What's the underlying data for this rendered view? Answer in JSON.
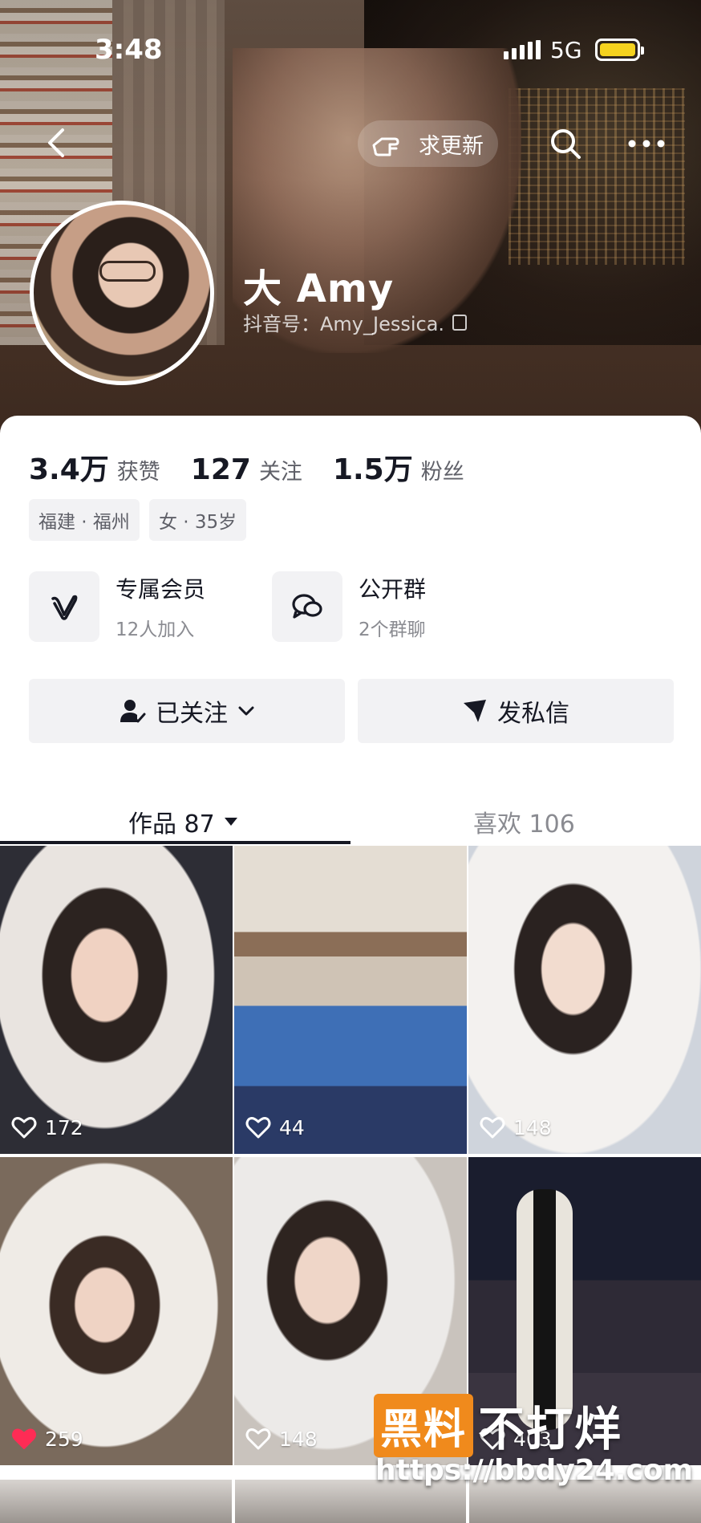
{
  "status_bar": {
    "time": "3:48",
    "network": "5G"
  },
  "header": {
    "request_update_label": "求更新"
  },
  "profile": {
    "name": "大 Amy",
    "douyin_id": "抖音号：Amy_Jessica."
  },
  "stats": [
    {
      "value": "3.4万",
      "label": "获赞"
    },
    {
      "value": "127",
      "label": "关注"
    },
    {
      "value": "1.5万",
      "label": "粉丝"
    }
  ],
  "tags": [
    "福建 · 福州",
    "女 · 35岁"
  ],
  "features": [
    {
      "title": "专属会员",
      "subtitle": "12人加入",
      "icon": "v-badge-icon"
    },
    {
      "title": "公开群",
      "subtitle": "2个群聊",
      "icon": "group-chat-icon"
    }
  ],
  "actions": {
    "follow_label": "已关注",
    "message_label": "发私信"
  },
  "tabs": [
    {
      "label": "作品 87",
      "active": true
    },
    {
      "label": "喜欢 106",
      "active": false
    }
  ],
  "videos": [
    {
      "likes": "172",
      "liked": false
    },
    {
      "likes": "44",
      "liked": false
    },
    {
      "likes": "148",
      "liked": false
    },
    {
      "likes": "259",
      "liked": true
    },
    {
      "likes": "148",
      "liked": false
    },
    {
      "likes": "403",
      "liked": false
    }
  ],
  "watermark": {
    "brand_box": "黑料",
    "brand_rest": "不打烊",
    "url": "https://bbdy24.com"
  },
  "colors": {
    "liked_heart": "#fe2c55",
    "watermark_orange": "#f08a1c",
    "battery": "#f5d21e"
  }
}
